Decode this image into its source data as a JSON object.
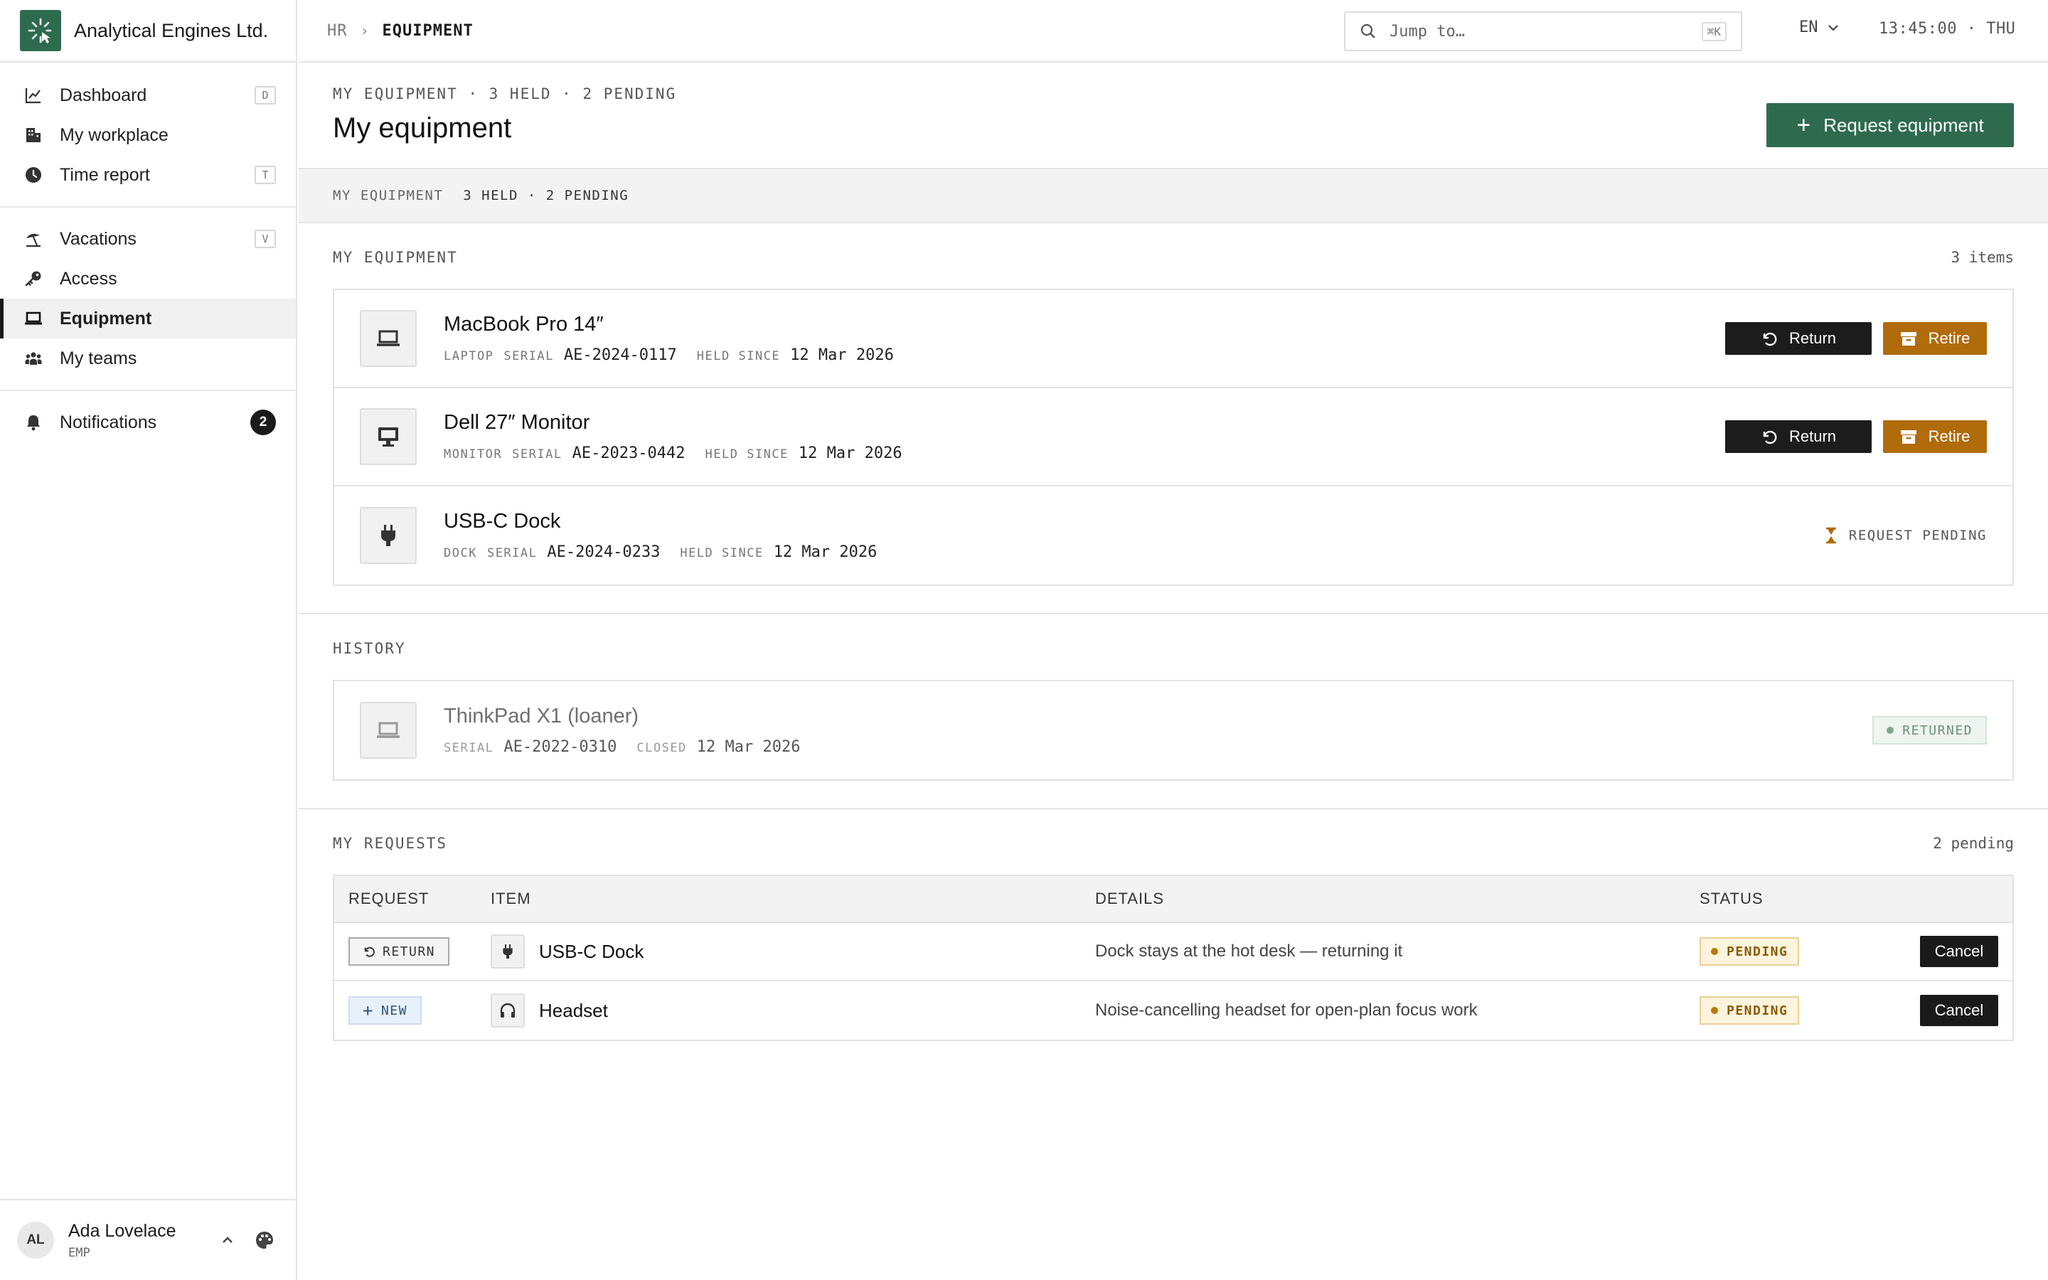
{
  "brand": {
    "name": "Analytical Engines Ltd."
  },
  "sidebar": {
    "groups": [
      {
        "items": [
          {
            "label": "Dashboard",
            "icon": "chart-line-icon",
            "shortcut": "D"
          },
          {
            "label": "My workplace",
            "icon": "building-icon",
            "shortcut": ""
          },
          {
            "label": "Time report",
            "icon": "clock-icon",
            "shortcut": "T"
          }
        ]
      },
      {
        "items": [
          {
            "label": "Vacations",
            "icon": "beach-umbrella-icon",
            "shortcut": "V"
          },
          {
            "label": "Access",
            "icon": "key-icon",
            "shortcut": ""
          },
          {
            "label": "Equipment",
            "icon": "laptop-icon",
            "shortcut": "",
            "active": true
          },
          {
            "label": "My teams",
            "icon": "team-icon",
            "shortcut": ""
          }
        ]
      },
      {
        "items": [
          {
            "label": "Notifications",
            "icon": "bell-icon",
            "count": "2"
          }
        ]
      }
    ],
    "user": {
      "initials": "AL",
      "name": "Ada Lovelace",
      "role": "EMP"
    }
  },
  "topbar": {
    "breadcrumb": {
      "parent": "HR",
      "separator": "›",
      "current": "EQUIPMENT"
    },
    "search": {
      "placeholder": "Jump to…",
      "shortcut": "⌘K"
    },
    "language": "EN",
    "clock": "13:45:00 · THU"
  },
  "page": {
    "eyebrow": "MY EQUIPMENT · 3 HELD · 2 PENDING",
    "title": "My equipment",
    "primary_action": "Request equipment",
    "summary": {
      "label": "MY EQUIPMENT",
      "value": "3 HELD · 2 PENDING"
    }
  },
  "equipment": {
    "title": "MY EQUIPMENT",
    "count": "3 items",
    "items": [
      {
        "name": "MacBook Pro 14″",
        "type": "LAPTOP",
        "serial_label": "SERIAL",
        "serial": "AE-2024-0117",
        "since_label": "HELD SINCE",
        "since": "12 Mar 2026",
        "icon": "laptop-icon",
        "return_label": "Return",
        "retire_label": "Retire"
      },
      {
        "name": "Dell 27″ Monitor",
        "type": "MONITOR",
        "serial_label": "SERIAL",
        "serial": "AE-2023-0442",
        "since_label": "HELD SINCE",
        "since": "12 Mar 2026",
        "icon": "monitor-icon",
        "return_label": "Return",
        "retire_label": "Retire"
      },
      {
        "name": "USB-C Dock",
        "type": "DOCK",
        "serial_label": "SERIAL",
        "serial": "AE-2024-0233",
        "since_label": "HELD SINCE",
        "since": "12 Mar 2026",
        "icon": "plug-icon",
        "status": "REQUEST PENDING"
      }
    ]
  },
  "history": {
    "title": "HISTORY",
    "items": [
      {
        "name": "ThinkPad X1 (loaner)",
        "serial_label": "SERIAL",
        "serial": "AE-2022-0310",
        "closed_label": "CLOSED",
        "closed": "12 Mar 2026",
        "status": "RETURNED",
        "icon": "laptop-icon"
      }
    ]
  },
  "requests": {
    "title": "MY REQUESTS",
    "count": "2 pending",
    "columns": [
      "REQUEST",
      "ITEM",
      "DETAILS",
      "STATUS"
    ],
    "rows": [
      {
        "type": "RETURN",
        "item": "USB-C Dock",
        "item_icon": "plug-icon",
        "details": "Dock stays at the hot desk — returning it",
        "status": "PENDING",
        "action": "Cancel"
      },
      {
        "type": "NEW",
        "item": "Headset",
        "item_icon": "headphones-icon",
        "details": "Noise-cancelling headset for open-plan focus work",
        "status": "PENDING",
        "action": "Cancel"
      }
    ]
  },
  "colors": {
    "brand": "#2e6b4e",
    "retire": "#b06b0a",
    "pending": "#b97a06",
    "dark": "#1a1a1a"
  }
}
